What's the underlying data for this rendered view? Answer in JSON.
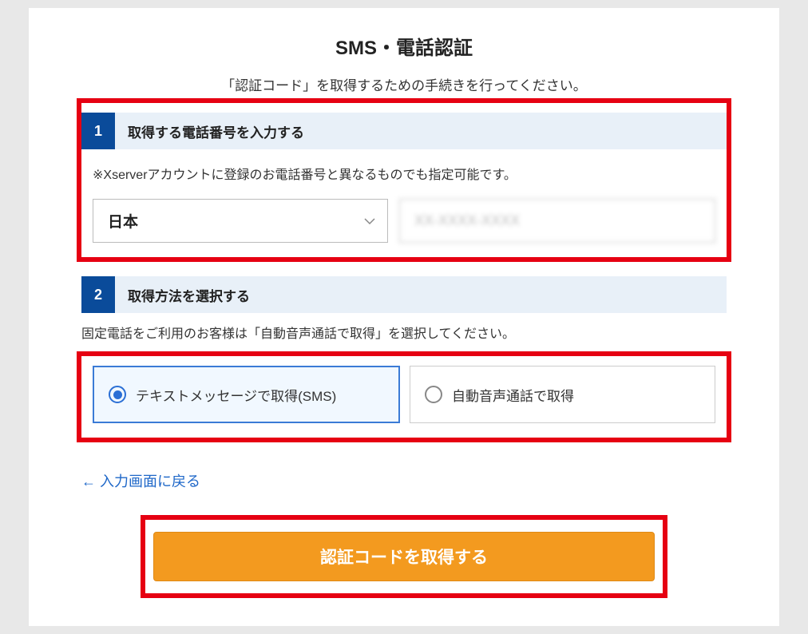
{
  "title": "SMS・電話認証",
  "subtitle": "「認証コード」を取得するための手続きを行ってください。",
  "step1": {
    "num": "1",
    "label": "取得する電話番号を入力する",
    "note": "※Xserverアカウントに登録のお電話番号と異なるものでも指定可能です。",
    "country_selected": "日本",
    "phone_value": "XX-XXXX-XXXX"
  },
  "step2": {
    "num": "2",
    "label": "取得方法を選択する",
    "note": "固定電話をご利用のお客様は「自動音声通話で取得」を選択してください。",
    "option_sms": "テキストメッセージで取得(SMS)",
    "option_voice": "自動音声通話で取得"
  },
  "back_link": "← 入力画面に戻る",
  "submit_label": "認証コードを取得する"
}
